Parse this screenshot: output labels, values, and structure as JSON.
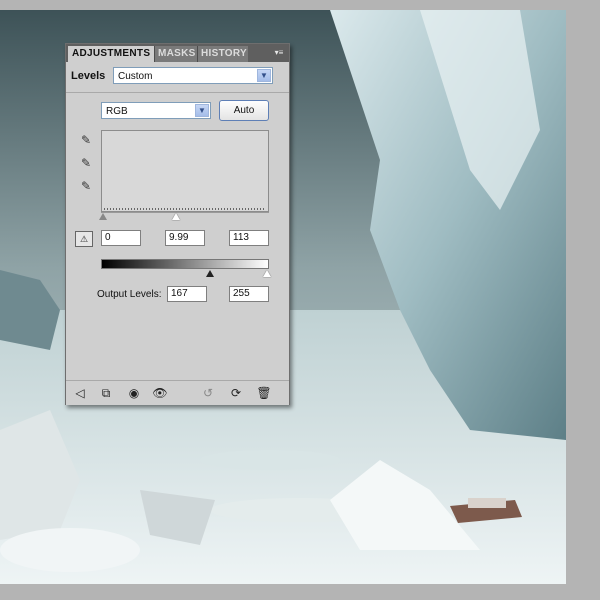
{
  "panel": {
    "tabs": [
      {
        "label": "ADJUSTMENTS",
        "active": true
      },
      {
        "label": "MASKS",
        "active": false
      },
      {
        "label": "HISTORY",
        "active": false
      }
    ],
    "menu_icon": "panel-menu-icon",
    "levels_label": "Levels",
    "preset_value": "Custom",
    "channel_value": "RGB",
    "auto_label": "Auto",
    "input_levels": {
      "black": "0",
      "gamma": "9.99",
      "white": "113"
    },
    "output_label": "Output Levels:",
    "output_levels": {
      "black": "167",
      "white": "255"
    },
    "eyedroppers": [
      "black-eyedropper-icon",
      "gray-eyedropper-icon",
      "white-eyedropper-icon"
    ],
    "footer_icons": [
      "back-arrow-icon",
      "clip-to-layer-icon",
      "visibility-toggle-icon",
      "view-previous-icon",
      "reset-icon",
      "refresh-icon",
      "trash-icon"
    ]
  },
  "colors": {
    "panel_bg": "#cfcfcf",
    "tab_bar": "#5f5f5f",
    "canvas_bg": "#b4b4b4"
  }
}
